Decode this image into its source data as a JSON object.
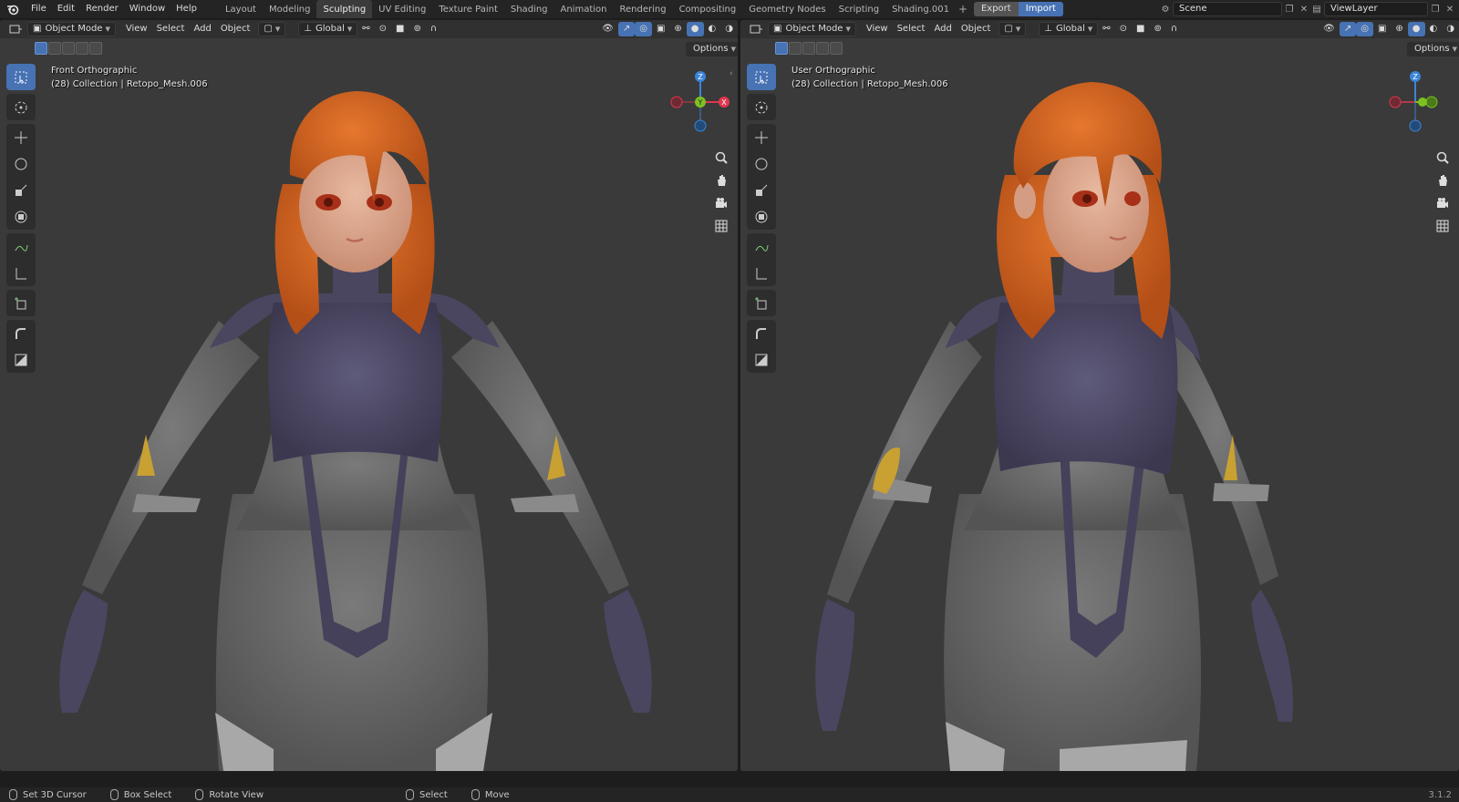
{
  "top_menu": [
    "File",
    "Edit",
    "Render",
    "Window",
    "Help"
  ],
  "workspace_tabs": [
    "Layout",
    "Modeling",
    "Sculpting",
    "UV Editing",
    "Texture Paint",
    "Shading",
    "Animation",
    "Rendering",
    "Compositing",
    "Geometry Nodes",
    "Scripting",
    "Shading.001"
  ],
  "active_tab": "Sculpting",
  "export_label": "Export",
  "import_label": "Import",
  "scene_name": "Scene",
  "view_layer": "ViewLayer",
  "viewport_left": {
    "mode": "Object Mode",
    "menus": [
      "View",
      "Select",
      "Add",
      "Object"
    ],
    "orientation": "Global",
    "options": "Options",
    "view_name": "Front Orthographic",
    "collection": "(28) Collection | Retopo_Mesh.006",
    "gizmo_axes": {
      "z": "Z",
      "y": "Y",
      "x": "X"
    }
  },
  "viewport_right": {
    "mode": "Object Mode",
    "menus": [
      "View",
      "Select",
      "Add",
      "Object"
    ],
    "orientation": "Global",
    "options": "Options",
    "view_name": "User Orthographic",
    "collection": "(28) Collection | Retopo_Mesh.006",
    "gizmo_axes": {
      "z": "Z"
    }
  },
  "status_bar": {
    "items": [
      "Set 3D Cursor",
      "Box Select",
      "Rotate View",
      "Select",
      "Move"
    ],
    "version": "3.1.2"
  },
  "colors": {
    "accent": "#4772b3",
    "viewport_bg": "#3a3a3a",
    "hair": "#d4621f",
    "suit_dark": "#4a4660",
    "suit_grey": "#6a6a6a",
    "gold": "#c9a032",
    "axis_x": "#e0384f",
    "axis_y": "#7cc321",
    "axis_z": "#3a85d8"
  }
}
